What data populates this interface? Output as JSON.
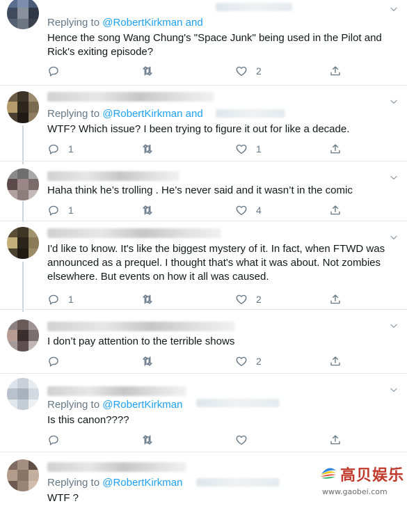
{
  "tweets": [
    {
      "replying_prefix": "Replying to",
      "mention": "@RobertKirkman and",
      "text": "Hence the song Wang Chung's \"Space Junk\" being used in the Pilot and Rick's exiting episode?",
      "reply_count": "",
      "like_count": "2"
    },
    {
      "replying_prefix": "Replying to",
      "mention": "@RobertKirkman and",
      "text": "WTF? Which issue? I been trying to figure it out for like a decade.",
      "reply_count": "1",
      "like_count": "1"
    },
    {
      "replying_prefix": "",
      "mention": "",
      "text": "Haha think he’s trolling . He’s never said and it wasn’t in the comic",
      "reply_count": "1",
      "like_count": "4"
    },
    {
      "replying_prefix": "",
      "mention": "",
      "text": "I'd like to know. It's like the biggest mystery of it. In fact, when FTWD was announced as a prequel. I thought that's what it was about. Not zombies elsewhere. But events on how it all was caused.",
      "reply_count": "1",
      "like_count": "2"
    },
    {
      "replying_prefix": "",
      "mention": "",
      "text": "I don’t pay attention to the terrible shows",
      "reply_count": "",
      "like_count": "2"
    },
    {
      "replying_prefix": "Replying to",
      "mention": "@RobertKirkman",
      "text": "Is this canon????",
      "reply_count": "",
      "like_count": ""
    },
    {
      "replying_prefix": "Replying to",
      "mention": "@RobertKirkman",
      "text": "WTF ?",
      "reply_count": "",
      "like_count": ""
    }
  ],
  "watermark": {
    "name": "高贝娱乐",
    "url": "www.gaobei.com"
  },
  "colors": {
    "text": "#14171a",
    "secondary": "#657786",
    "link": "#1da1f2",
    "divider": "#e1e8ed"
  },
  "icons": [
    "reply-icon",
    "retweet-icon",
    "like-icon",
    "share-icon",
    "chevron-down-icon"
  ]
}
